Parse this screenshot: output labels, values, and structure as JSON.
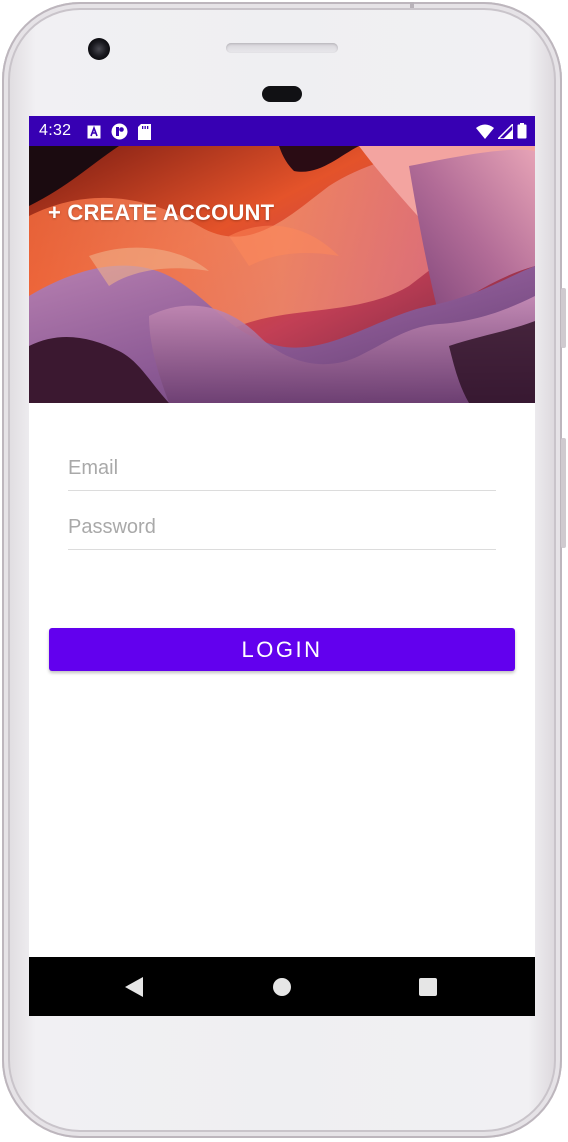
{
  "status_bar": {
    "time": "4:32",
    "left_icons": [
      "font-a-icon",
      "notification-app-icon",
      "sd-card-icon"
    ],
    "right_icons": [
      "wifi-icon",
      "signal-icon",
      "battery-icon"
    ],
    "color": "#3700b3"
  },
  "header": {
    "create_account_label": "+ CREATE ACCOUNT",
    "background_image": "canyon-photo"
  },
  "form": {
    "email_placeholder": "Email",
    "email_value": "",
    "password_placeholder": "Password",
    "password_value": ""
  },
  "actions": {
    "login_label": "LOGIN",
    "accent_color": "#6200ee"
  },
  "nav_bar": {
    "buttons": [
      "back-icon",
      "home-icon",
      "recents-icon"
    ]
  }
}
